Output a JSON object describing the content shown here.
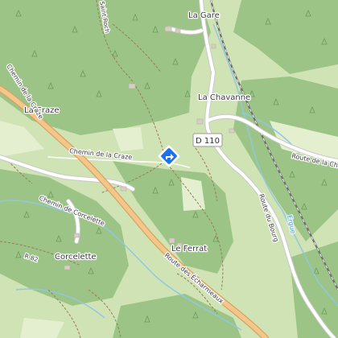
{
  "map": {
    "colors": {
      "meadow": "#cfe3b4",
      "forest": "#9cc487",
      "forest_dark": "#8fba7a",
      "clearing": "#e4efcf",
      "road_primary_fill": "#f3c78c",
      "road_primary_casing": "#d9a25c",
      "road_secondary": "#ffffff",
      "road_casing": "#c9c9c9",
      "river": "#8fc7e6",
      "railway": "#6f6f6f",
      "track": "#9a7a5a",
      "building": "#d6cfc4",
      "marker": "#1a73e8"
    },
    "places": {
      "la_gare": "La Gare",
      "la_chavanne": "La Chavanne",
      "la_craze": "La Craze",
      "corcelette": "Corcelette",
      "le_ferrat": "Le Ferrat"
    },
    "roads": {
      "chemin_de_la_craze_top": "Chemin de la Craze",
      "chemin_de_la_craze": "Chemin de la Craze",
      "chemin_de_corcelette": "Chemin de Corcelette",
      "route_des_echarmeaux": "Route des Écharmeaux",
      "route_du_bourg": "Route du Bourg",
      "route_de_la_che": "Route de la Che",
      "saint_roch": "Saint Roch",
      "r82": "R 82"
    },
    "road_shield": "D 110",
    "water": {
      "ergue": "Ergue"
    },
    "marker": {
      "icon": "directions-diamond-icon"
    }
  }
}
